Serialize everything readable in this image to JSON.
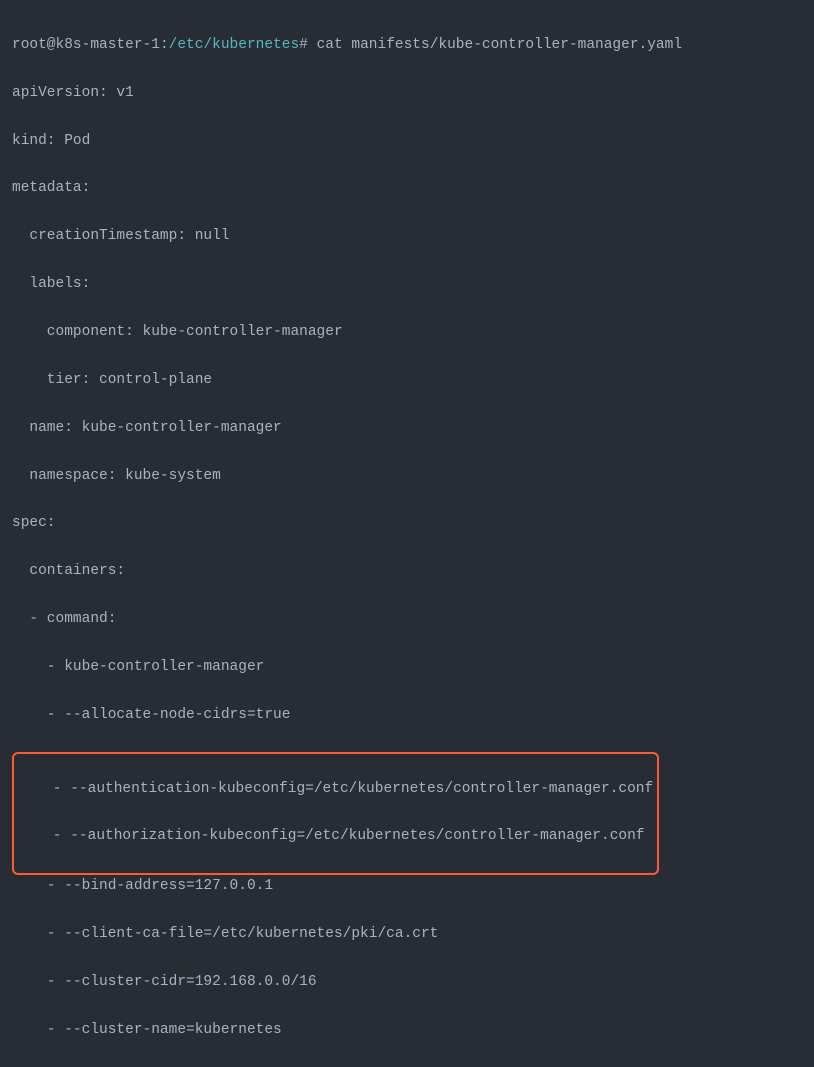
{
  "prompt": {
    "user": "root@k8s-master-1",
    "separator": ":",
    "path": "/etc/kubernetes",
    "symbol": "#",
    "command": "cat manifests/kube-controller-manager.yaml"
  },
  "yaml": {
    "apiVersion": "apiVersion: v1",
    "kind": "kind: Pod",
    "metadata": "metadata:",
    "creationTimestamp": "  creationTimestamp: null",
    "labels": "  labels:",
    "component": "    component: kube-controller-manager",
    "tier": "    tier: control-plane",
    "name": "  name: kube-controller-manager",
    "namespace": "  namespace: kube-system",
    "spec": "spec:",
    "containers": "  containers:",
    "commandKey": "  - command:",
    "cmd1": "    - kube-controller-manager",
    "cmd2": "    - --allocate-node-cidrs=true",
    "cmd3": "    - --authentication-kubeconfig=/etc/kubernetes/controller-manager.conf",
    "cmd4": "    - --authorization-kubeconfig=/etc/kubernetes/controller-manager.conf",
    "cmd5": "    - --bind-address=127.0.0.1",
    "cmd6": "    - --client-ca-file=/etc/kubernetes/pki/ca.crt",
    "cmd7": "    - --cluster-cidr=192.168.0.0/16",
    "cmd8": "    - --cluster-name=kubernetes"
  }
}
